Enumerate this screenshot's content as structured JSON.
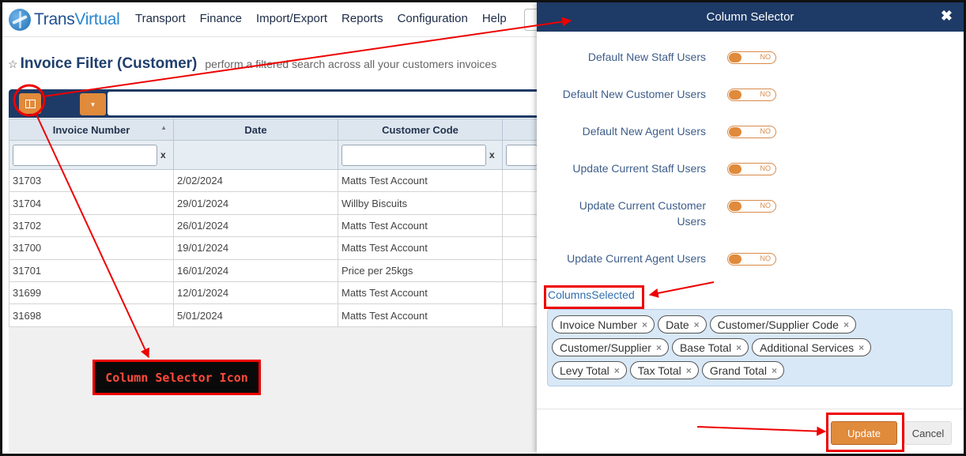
{
  "app": {
    "logo_text_a": "Trans",
    "logo_text_b": "Virtual",
    "menu": [
      "Transport",
      "Finance",
      "Import/Export",
      "Reports",
      "Configuration",
      "Help"
    ]
  },
  "page": {
    "title": "Invoice Filter (Customer)",
    "subtitle": "perform a filtered search across all your customers invoices"
  },
  "grid": {
    "columns": [
      "Invoice Number",
      "Date",
      "Customer Code"
    ],
    "filter_clear": "x",
    "rows": [
      [
        "31703",
        "2/02/2024",
        "Matts Test Account"
      ],
      [
        "31704",
        "29/01/2024",
        "Willby Biscuits"
      ],
      [
        "31702",
        "26/01/2024",
        "Matts Test Account"
      ],
      [
        "31700",
        "19/01/2024",
        "Matts Test Account"
      ],
      [
        "31701",
        "16/01/2024",
        "Price per 25kgs"
      ],
      [
        "31699",
        "12/01/2024",
        "Matts Test Account"
      ],
      [
        "31698",
        "5/01/2024",
        "Matts Test Account"
      ]
    ]
  },
  "modal": {
    "title": "Column Selector",
    "close": "✖",
    "options": [
      {
        "label": "Default New Staff Users",
        "state": "NO"
      },
      {
        "label": "Default New Customer Users",
        "state": "NO"
      },
      {
        "label": "Default New Agent Users",
        "state": "NO"
      },
      {
        "label": "Update Current Staff Users",
        "state": "NO"
      },
      {
        "label": "Update Current Customer Users",
        "state": "NO"
      },
      {
        "label": "Update Current Agent Users",
        "state": "NO"
      }
    ],
    "columns_label": "ColumnsSelected",
    "selected_columns": [
      "Invoice Number",
      "Date",
      "Customer/Supplier Code",
      "Customer/Supplier",
      "Base Total",
      "Additional Services",
      "Levy Total",
      "Tax Total",
      "Grand Total"
    ],
    "tag_remove": "×",
    "update_label": "Update",
    "cancel_label": "Cancel"
  },
  "annotation": {
    "callout_text": "Column Selector Icon"
  },
  "colors": {
    "navy": "#1e3a66",
    "accent_orange": "#e08a3c",
    "annotation_red": "#e00000"
  }
}
